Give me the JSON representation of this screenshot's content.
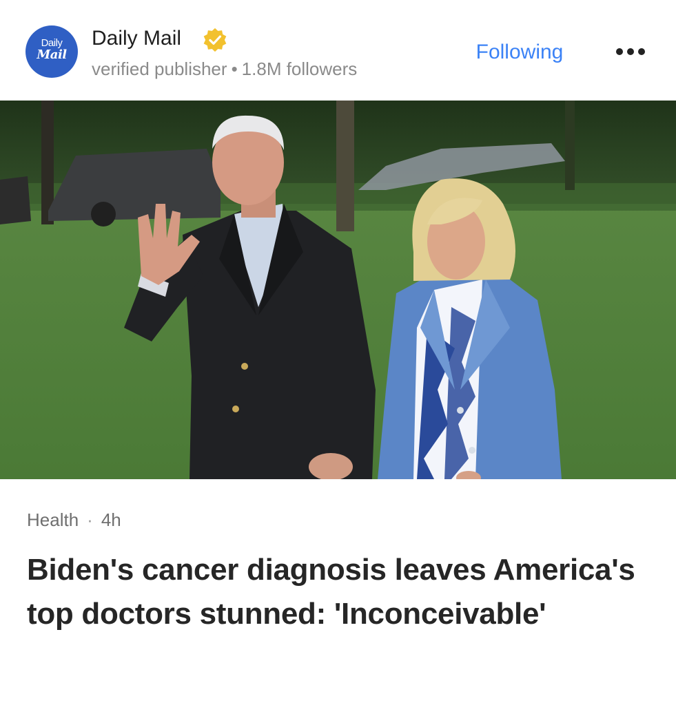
{
  "publisher": {
    "logo_line1": "Daily",
    "logo_line2": "Mail",
    "name": "Daily Mail",
    "type": "verified publisher",
    "separator": "•",
    "followers": "1.8M followers",
    "follow_label": "Following",
    "icons": {
      "verified": "verified-badge-icon",
      "more": "more-options-icon"
    },
    "colors": {
      "logo_bg": "#2f5fc4",
      "follow": "#3b82f6",
      "badge": "#f2c12e"
    }
  },
  "article": {
    "category": "Health",
    "separator": "·",
    "age": "4h",
    "headline": "Biden's cancer diagnosis leaves America's top doctors stunned: 'Inconceivable'"
  }
}
